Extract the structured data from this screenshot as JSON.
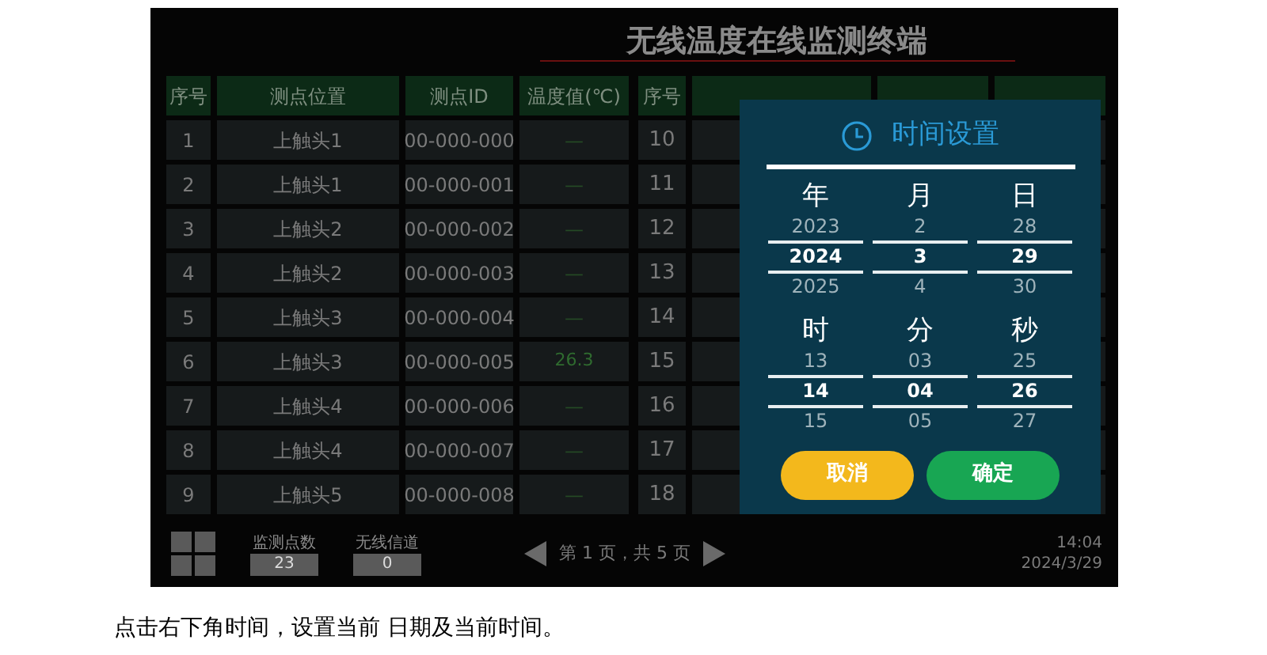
{
  "title": "无线温度在线监测终端",
  "left_table": {
    "columns": [
      "序号",
      "测点位置",
      "测点ID",
      "温度值(℃)"
    ],
    "rows": [
      {
        "cells": [
          "1",
          "上触头1",
          "00-000-000",
          "—"
        ],
        "reading": false
      },
      {
        "cells": [
          "2",
          "上触头1",
          "00-000-001",
          "—"
        ],
        "reading": false
      },
      {
        "cells": [
          "3",
          "上触头2",
          "00-000-002",
          "—"
        ],
        "reading": false
      },
      {
        "cells": [
          "4",
          "上触头2",
          "00-000-003",
          "—"
        ],
        "reading": false
      },
      {
        "cells": [
          "5",
          "上触头3",
          "00-000-004",
          "—"
        ],
        "reading": false
      },
      {
        "cells": [
          "6",
          "上触头3",
          "00-000-005",
          "26.3"
        ],
        "reading": true
      },
      {
        "cells": [
          "7",
          "上触头4",
          "00-000-006",
          "—"
        ],
        "reading": false
      },
      {
        "cells": [
          "8",
          "上触头4",
          "00-000-007",
          "—"
        ],
        "reading": false
      },
      {
        "cells": [
          "9",
          "上触头5",
          "00-000-008",
          "—"
        ],
        "reading": false
      }
    ]
  },
  "right_table": {
    "columns": [
      "序号"
    ],
    "rows": [
      "10",
      "11",
      "12",
      "13",
      "14",
      "15",
      "16",
      "17",
      "18"
    ]
  },
  "footer": {
    "stats": [
      {
        "label": "监测点数",
        "value": "23"
      },
      {
        "label": "无线信道",
        "value": "0"
      }
    ],
    "pager": "第 1 页，共 5 页",
    "time": "14:04",
    "date": "2024/3/29"
  },
  "dialog": {
    "title": "时间设置",
    "pickers": [
      {
        "label": "年",
        "prev": "2023",
        "current": "2024",
        "next": "2025"
      },
      {
        "label": "月",
        "prev": "2",
        "current": "3",
        "next": "4"
      },
      {
        "label": "日",
        "prev": "28",
        "current": "29",
        "next": "30"
      },
      {
        "label": "时",
        "prev": "13",
        "current": "14",
        "next": "15"
      },
      {
        "label": "分",
        "prev": "03",
        "current": "04",
        "next": "05"
      },
      {
        "label": "秒",
        "prev": "25",
        "current": "26",
        "next": "27"
      }
    ],
    "cancel": "取消",
    "confirm": "确定"
  },
  "caption": "点击右下角时间，设置当前 日期及当前时间。"
}
